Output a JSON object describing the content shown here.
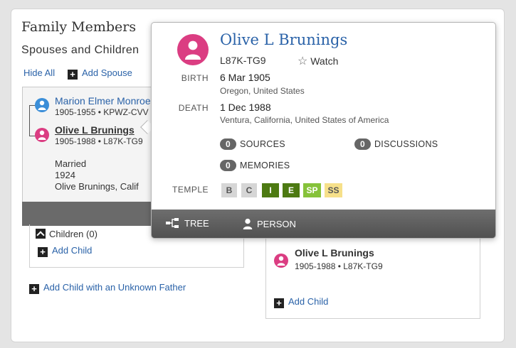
{
  "section": {
    "title": "Family Members",
    "subtitle": "Spouses and Children",
    "hide_all": "Hide All",
    "add_spouse": "Add Spouse"
  },
  "family_card": {
    "husband": {
      "name": "Marion Elmer Monroe",
      "meta": "1905-1955 • KPWZ-CVV"
    },
    "wife": {
      "name": "Olive L Brunings",
      "meta": "1905-1988 • L87K-TG9"
    },
    "relationship": "Married",
    "year": "1924",
    "place": "Olive Brunings, Calif"
  },
  "children": {
    "label": "Children",
    "count": "(0)",
    "add_child": "Add Child",
    "add_unknown_father": "Add Child with an Unknown Father"
  },
  "right_family": {
    "name": "Olive L Brunings",
    "meta": "1905-1988 • L87K-TG9",
    "add_child": "Add Child"
  },
  "popup": {
    "name": "Olive L Brunings",
    "id": "L87K-TG9",
    "watch": "Watch",
    "birth_label": "BIRTH",
    "birth_date": "6 Mar 1905",
    "birth_place": "Oregon, United States",
    "death_label": "DEATH",
    "death_date": "1 Dec 1988",
    "death_place": "Ventura, California, United States of America",
    "sources": {
      "count": "0",
      "label": "SOURCES"
    },
    "discussions": {
      "count": "0",
      "label": "DISCUSSIONS"
    },
    "memories": {
      "count": "0",
      "label": "MEMORIES"
    },
    "temple_label": "TEMPLE",
    "temple": [
      {
        "code": "B",
        "bg": "#d6d6d6",
        "fg": "#555"
      },
      {
        "code": "C",
        "bg": "#d6d6d6",
        "fg": "#555"
      },
      {
        "code": "I",
        "bg": "#4d7a12",
        "fg": "#ffffff"
      },
      {
        "code": "E",
        "bg": "#4d7a12",
        "fg": "#ffffff"
      },
      {
        "code": "SP",
        "bg": "#86c23a",
        "fg": "#ffffff"
      },
      {
        "code": "SS",
        "bg": "#f6e08a",
        "fg": "#555"
      }
    ],
    "footer": {
      "tree": "TREE",
      "person": "PERSON"
    }
  },
  "colors": {
    "link": "#2a62a8",
    "female": "#db3d82",
    "male": "#3b8ed8"
  }
}
